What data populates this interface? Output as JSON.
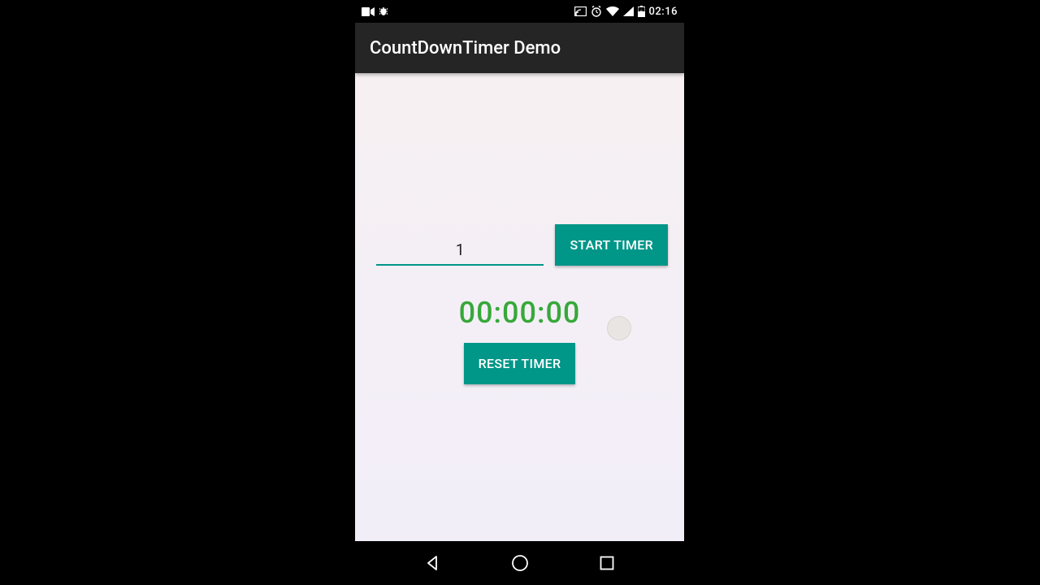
{
  "status": {
    "time": "02:16"
  },
  "app": {
    "title": "CountDownTimer Demo"
  },
  "main": {
    "minutes_value": "1",
    "start_label": "START TIMER",
    "timer_display": "00:00:00",
    "reset_label": "RESET TIMER"
  },
  "colors": {
    "accent": "#009688",
    "timer_text": "#37a83a"
  }
}
